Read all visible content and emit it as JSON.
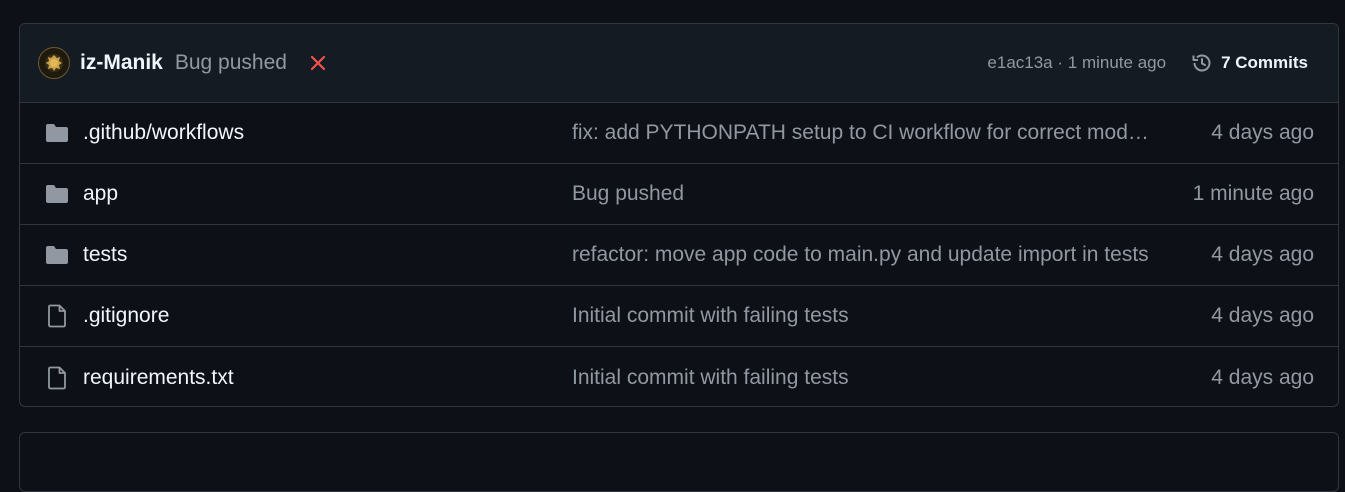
{
  "commit_header": {
    "author": "iz-Manik",
    "message": "Bug pushed",
    "status": "failure",
    "hash": "e1ac13a",
    "separator": "·",
    "time": "1 minute ago",
    "commits_label": "7 Commits"
  },
  "files": [
    {
      "name": ".github/workflows",
      "type": "folder",
      "message": "fix: add PYTHONPATH setup to CI workflow for correct module resolution",
      "time": "4 days ago"
    },
    {
      "name": "app",
      "type": "folder",
      "message": "Bug pushed",
      "time": "1 minute ago"
    },
    {
      "name": "tests",
      "type": "folder",
      "message": "refactor: move app code to main.py and update import in tests",
      "time": "4 days ago"
    },
    {
      "name": ".gitignore",
      "type": "file",
      "message": "Initial commit with failing tests",
      "time": "4 days ago"
    },
    {
      "name": "requirements.txt",
      "type": "file",
      "message": "Initial commit with failing tests",
      "time": "4 days ago"
    }
  ],
  "colors": {
    "background": "#0d1117",
    "header_bg": "#151b23",
    "border": "#30363d",
    "muted": "#9198a1",
    "failure": "#f85149",
    "folder_icon": "#9198a1"
  }
}
